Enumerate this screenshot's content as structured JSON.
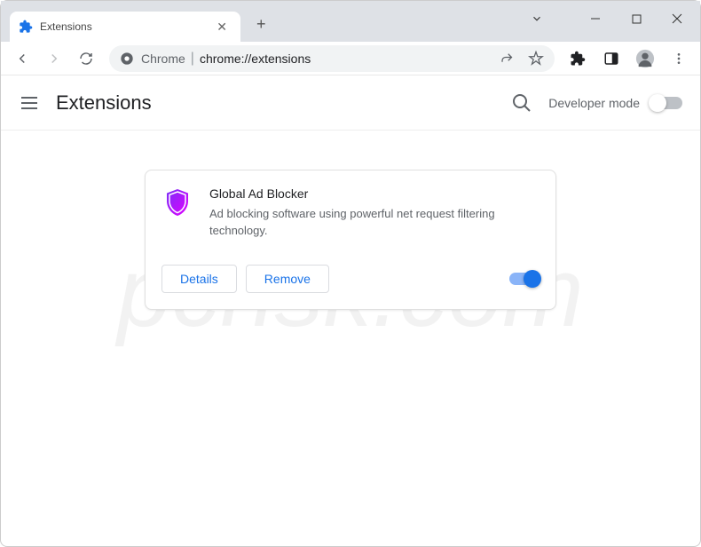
{
  "window": {
    "tab_title": "Extensions"
  },
  "omnibox": {
    "prefix": "Chrome",
    "url": "chrome://extensions"
  },
  "ext_page": {
    "title": "Extensions",
    "dev_mode_label": "Developer mode",
    "dev_mode_on": false
  },
  "extension": {
    "name": "Global Ad Blocker",
    "description": "Ad blocking software using powerful net request filtering technology.",
    "details_label": "Details",
    "remove_label": "Remove",
    "enabled": true
  },
  "watermark": "pcrisk.com"
}
